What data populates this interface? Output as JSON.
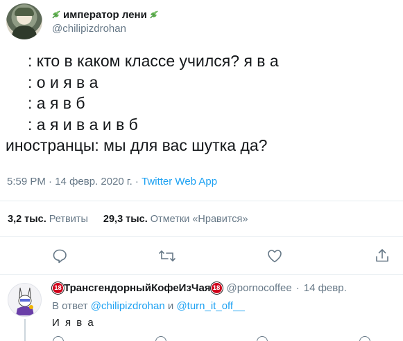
{
  "tweet": {
    "display_name": "император лени",
    "handle": "@chilipizdrohan",
    "lines": [
      {
        "flag": "russia",
        "text": ": кто в каком классе учился? я в а"
      },
      {
        "flag": "ukraine",
        "text": ": о и я в а"
      },
      {
        "flag": "belarus",
        "text": ": а я в б"
      },
      {
        "flag": "kazakhstan",
        "text": ": а я и в а и в б"
      },
      {
        "flag": "",
        "text": "иностранцы: мы для вас шутка да?"
      }
    ],
    "time": "5:59 PM",
    "date": "14 февр. 2020 г.",
    "separator": "·",
    "client": "Twitter Web App",
    "retweets_count": "3,2 тыс.",
    "retweets_label": "Ретвиты",
    "likes_count": "29,3 тыс.",
    "likes_label": "Отметки «Нравится»",
    "colors": {
      "accent": "#1da1f2",
      "muted": "#657786",
      "text": "#14171a",
      "divider": "#e6ecf0"
    }
  },
  "reply": {
    "display_name": "ТрансгендорныйКофеИзЧая",
    "badge": "18",
    "handle": "@pornocoffee",
    "separator": "·",
    "date": "14 февр.",
    "to_prefix": "В ответ",
    "to_user1": "@chilipizdrohan",
    "to_and": "и",
    "to_user2": "@turn_it_off__",
    "text": "И я в а"
  }
}
